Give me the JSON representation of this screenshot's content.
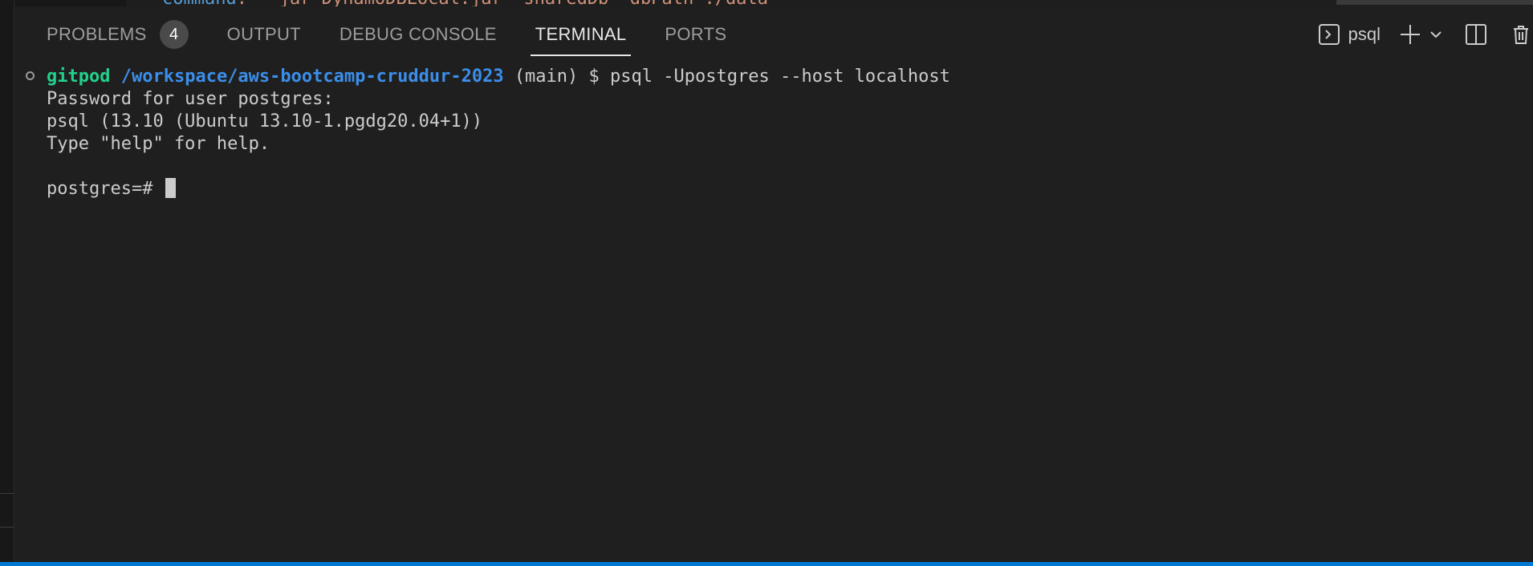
{
  "editor": {
    "code_key": "command",
    "code_value": ": \"-jar DynamoDBLocal.jar -sharedDb -dbPath ./data\""
  },
  "panel": {
    "tabs": [
      {
        "label": "PROBLEMS",
        "badge": "4",
        "active": false
      },
      {
        "label": "OUTPUT",
        "active": false
      },
      {
        "label": "DEBUG CONSOLE",
        "active": false
      },
      {
        "label": "TERMINAL",
        "active": true
      },
      {
        "label": "PORTS",
        "active": false
      }
    ]
  },
  "toolbar": {
    "terminal_name": "psql",
    "icons": [
      "terminal-icon",
      "plus-icon",
      "chevron-down-icon",
      "split-terminal-icon",
      "trash-icon"
    ]
  },
  "terminal": {
    "prompt_user": "gitpod",
    "prompt_path": "/workspace/aws-bootcamp-cruddur-2023",
    "prompt_branch": "(main)",
    "prompt_symbol": "$",
    "command": "psql -Upostgres --host localhost",
    "lines": [
      "Password for user postgres:",
      "psql (13.10 (Ubuntu 13.10-1.pgdg20.04+1))",
      "Type \"help\" for help.",
      ""
    ],
    "current_prompt": "postgres=# "
  },
  "colors": {
    "background": "#1f1f1f",
    "prompt_user": "#23d18b",
    "prompt_path": "#3b8eea",
    "accent": "#0078d4"
  }
}
